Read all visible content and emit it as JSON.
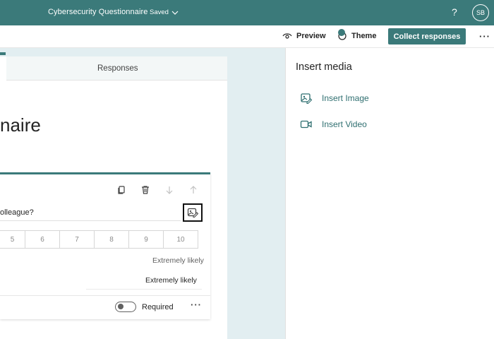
{
  "topbar": {
    "title": "Cybersecurity Questionnaire",
    "separator": "-",
    "status": "Saved",
    "help": "?",
    "avatar_initials": "SB"
  },
  "commandbar": {
    "preview_label": "Preview",
    "theme_label": "Theme",
    "collect_label": "Collect responses",
    "more_label": "···"
  },
  "form": {
    "tab_responses": "Responses",
    "title_visible": "naire",
    "question_text": "olleague?",
    "scale": [
      "5",
      "6",
      "7",
      "8",
      "9",
      "10"
    ],
    "high_label": "Extremely likely",
    "high_label_input": "Extremely likely",
    "required_label": "Required",
    "required_on": false,
    "more_label": "···"
  },
  "panel": {
    "title": "Insert media",
    "items": [
      {
        "label": "Insert Image",
        "icon": "image-edit-icon"
      },
      {
        "label": "Insert Video",
        "icon": "video-camera-icon"
      }
    ]
  },
  "colors": {
    "brand": "#3b7a7a",
    "link": "#2f6f70",
    "canvas": "#e2eef1"
  }
}
